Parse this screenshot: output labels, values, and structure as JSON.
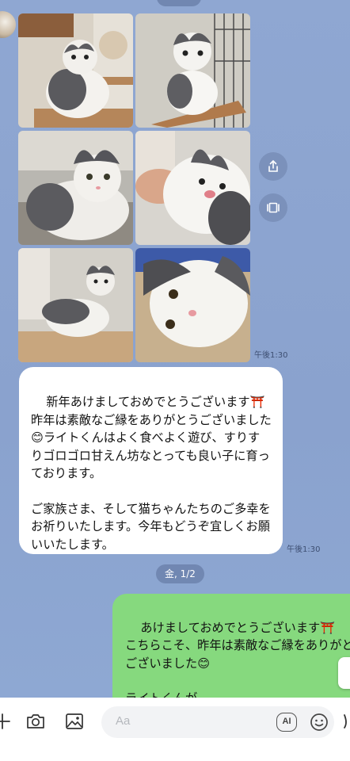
{
  "photo_message": {
    "photos": [
      "cat-photo-1",
      "cat-photo-2",
      "cat-photo-3",
      "cat-photo-4",
      "cat-photo-5",
      "cat-photo-6"
    ],
    "time": "午後1:30",
    "actions": [
      {
        "name": "share-icon"
      },
      {
        "name": "album-icon"
      }
    ]
  },
  "incoming_message": {
    "text": "新年あけましておめでとうございます⛩️\n昨年は素敵なご縁をありがとうございました😊ライトくんはよく食べよく遊び、すりすりゴロゴロ甘えん坊なとっても良い子に育っております。\n\nご家族さま、そして猫ちゃんたちのご多幸をお祈りいたします。今年もどうぞ宜しくお願いいたします。",
    "time": "午後1:30"
  },
  "date_separator": "金, 1/2",
  "outgoing_message": {
    "text": "あけましておめでとうございます⛩️\nこちらこそ、昨年は素敵なご縁をありがとうございました😊\n\nライトくんが\nよく食べて、よく遊んで、甘えん坊"
  },
  "input_bar": {
    "placeholder": "Aa",
    "ai_label": "AI",
    "icons": [
      "plus-icon",
      "camera-icon",
      "image-icon",
      "emoji-icon"
    ]
  },
  "colors": {
    "background": "#8ca4d0",
    "incoming_bubble": "#ffffff",
    "outgoing_bubble": "#86d97e"
  }
}
